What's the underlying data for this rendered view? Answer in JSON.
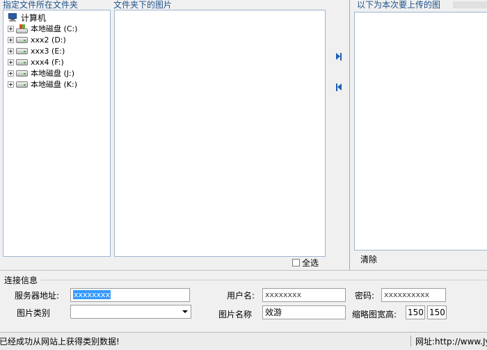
{
  "left_panel": {
    "title": "指定文件所在文件夹",
    "root_label": "计算机",
    "drives": [
      {
        "label": "本地磁盘 (C:)",
        "icon": "system-drive-icon"
      },
      {
        "label": "xxx2 (D:)",
        "icon": "drive-icon"
      },
      {
        "label": "xxx3 (E:)",
        "icon": "drive-icon"
      },
      {
        "label": "xxx4 (F:)",
        "icon": "drive-icon"
      },
      {
        "label": "本地磁盘 (J:)",
        "icon": "drive-icon"
      },
      {
        "label": "本地磁盘 (K:)",
        "icon": "drive-icon"
      }
    ]
  },
  "middle_panel": {
    "title": "文件夹下的图片",
    "select_all_label": "全选"
  },
  "right_panel": {
    "title": "以下为本次要上传的图",
    "clear_label": "清除"
  },
  "connection": {
    "title": "连接信息",
    "server_label": "服务器地址:",
    "server_value": "xxxxxxxx",
    "username_label": "用户名:",
    "username_value": "xxxxxxxx",
    "password_label": "密码:",
    "password_value": "xxxxxxxxxx",
    "category_label": "图片类别",
    "category_value": "",
    "image_name_label": "图片名称",
    "image_name_value": "效游",
    "thumb_label": "缩略图宽高:",
    "thumb_width": "150",
    "thumb_height": "150"
  },
  "status": {
    "message": "已经成功从网站上获得类别数据!",
    "url": "网址:http://www.Jy"
  },
  "colors": {
    "panel_title": "#1a4f8a",
    "panel_border": "#9cb6cf",
    "accent": "#1c5fb3",
    "selection": "#3399ff"
  }
}
